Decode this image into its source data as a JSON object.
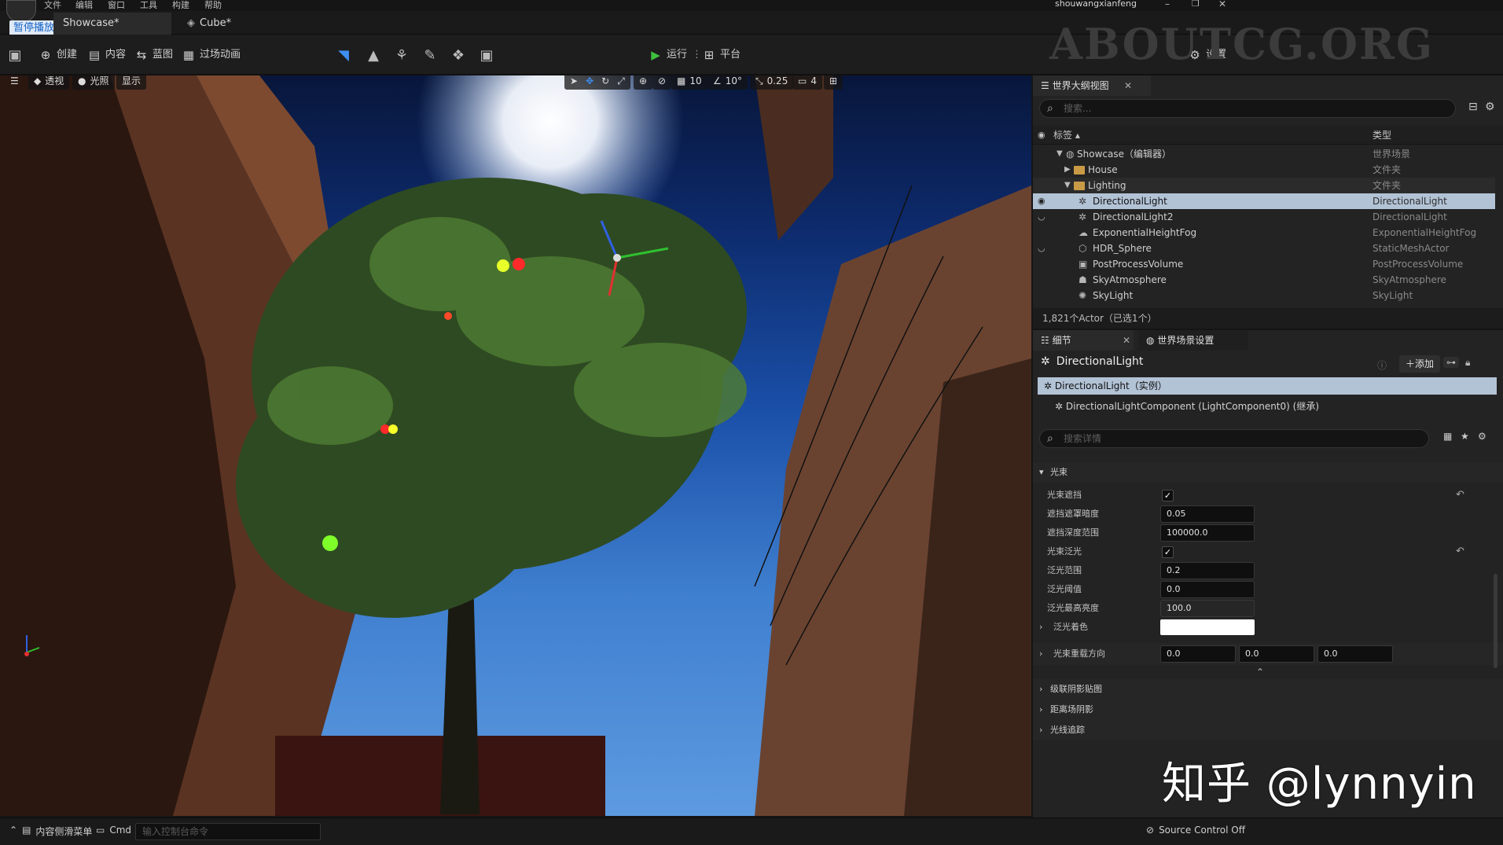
{
  "menu": [
    "文件",
    "编辑",
    "窗口",
    "工具",
    "构建",
    "帮助"
  ],
  "user": "shouwangxianfeng",
  "tabs": {
    "pause_badge": "暂停播放",
    "level": "Showcase*",
    "asset": "Cube*"
  },
  "toolbar": {
    "create": "创建",
    "content": "内容",
    "blueprint": "蓝图",
    "cinematics": "过场动画",
    "play": "运行",
    "platform": "平台",
    "settings": "设置"
  },
  "watermark": "ABOUTCG.ORG",
  "viewport": {
    "perspective": "透视",
    "lit": "光照",
    "show": "显示",
    "grid_snap": "10",
    "rotation_snap": "10°",
    "scale_snap": "0.25",
    "camera_speed": "4"
  },
  "outliner": {
    "tab": "世界大纲视图",
    "search_placeholder": "搜索...",
    "col_label": "标签 ▴",
    "col_type": "类型",
    "rows": [
      {
        "name": "Showcase（编辑器）",
        "type": "世界场景"
      },
      {
        "name": "House",
        "type": "文件夹"
      },
      {
        "name": "Lighting",
        "type": "文件夹"
      },
      {
        "name": "DirectionalLight",
        "type": "DirectionalLight"
      },
      {
        "name": "DirectionalLight2",
        "type": "DirectionalLight"
      },
      {
        "name": "ExponentialHeightFog",
        "type": "ExponentialHeightFog"
      },
      {
        "name": "HDR_Sphere",
        "type": "StaticMeshActor"
      },
      {
        "name": "PostProcessVolume",
        "type": "PostProcessVolume"
      },
      {
        "name": "SkyAtmosphere",
        "type": "SkyAtmosphere"
      },
      {
        "name": "SkyLight",
        "type": "SkyLight"
      }
    ],
    "count": "1,821个Actor（已选1个）"
  },
  "details": {
    "tab": "细节",
    "tab2": "世界场景设置",
    "actor": "DirectionalLight",
    "add": "添加",
    "instance": "DirectionalLight（实例）",
    "component": "DirectionalLightComponent (LightComponent0) (继承)",
    "search_placeholder": "搜索详情",
    "section": "光束",
    "props": [
      {
        "label": "光束遮挡",
        "checked": true
      },
      {
        "label": "遮挡遮罩暗度",
        "value": "0.05"
      },
      {
        "label": "遮挡深度范围",
        "value": "100000.0"
      },
      {
        "label": "光束泛光",
        "checked": true
      },
      {
        "label": "泛光范围",
        "value": "0.2"
      },
      {
        "label": "泛光阈值",
        "value": "0.0"
      },
      {
        "label": "泛光最高亮度",
        "value": "100.0"
      },
      {
        "label": "泛光着色"
      }
    ],
    "override": {
      "label": "光束重载方向",
      "x": "0.0",
      "y": "0.0",
      "z": "0.0"
    },
    "collapsed": [
      "级联阴影贴图",
      "距离场阴影",
      "光线追踪"
    ]
  },
  "status": {
    "drawer": "内容侧滑菜单",
    "cmd": "Cmd",
    "console_placeholder": "输入控制台命令",
    "source_control": "Source Control Off"
  },
  "credit": "知乎 @lynnyin"
}
